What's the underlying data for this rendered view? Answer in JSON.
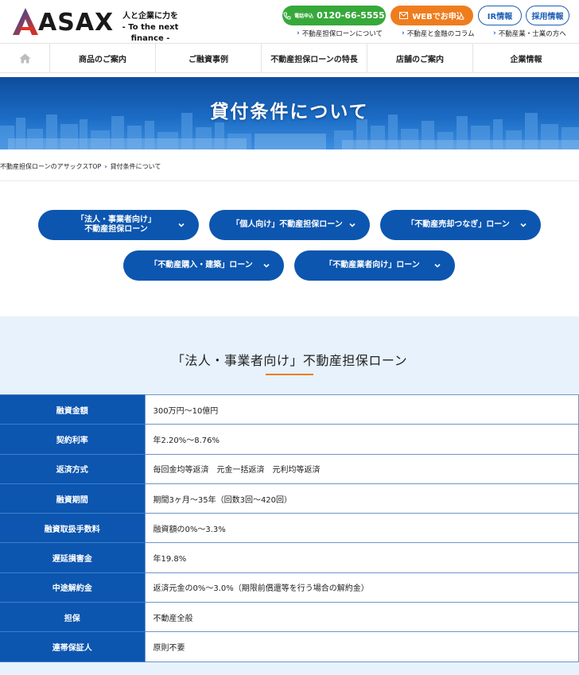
{
  "header": {
    "logo_text": "ASAX",
    "tagline_jp": "人と企業に力を",
    "tagline_en": "- To the next finance -",
    "tel_prefix": "電話申込",
    "tel_number": "0120-66-5555",
    "web_apply": "WEBでお申込",
    "ir": "IR情報",
    "recruit": "採用情報",
    "sublinks": [
      "不動産担保ローンについて",
      "不動産と金融のコラム",
      "不動産業・士業の方へ"
    ]
  },
  "nav": {
    "home_icon": "home-icon",
    "items": [
      "商品のご案内",
      "ご融資事例",
      "不動産担保ローンの特長",
      "店舗のご案内",
      "企業情報"
    ]
  },
  "hero": {
    "title": "貸付条件について"
  },
  "breadcrumb": {
    "home": "不動産担保ローンのアサックスTOP",
    "current": "貸付条件について"
  },
  "loan_buttons": [
    "「法人・事業者向け」\n不動産担保ローン",
    "「個人向け」不動産担保ローン",
    "「不動産売却つなぎ」ローン",
    "「不動産購入・建築」ローン",
    "「不動産業者向け」ローン"
  ],
  "section": {
    "title": "「法人・事業者向け」不動産担保ローン",
    "rows": [
      {
        "label": "融資金額",
        "value": "300万円〜10億円"
      },
      {
        "label": "契約利率",
        "value": "年2.20%〜8.76%"
      },
      {
        "label": "返済方式",
        "value": "毎回金均等返済　元金一括返済　元利均等返済"
      },
      {
        "label": "融資期間",
        "value": "期間3ヶ月〜35年（回数3回〜420回）"
      },
      {
        "label": "融資取扱手数料",
        "value": "融資額の0%〜3.3%"
      },
      {
        "label": "遅延損害金",
        "value": "年19.8%"
      },
      {
        "label": "中途解約金",
        "value": "返済元金の0%〜3.0%（期限前償還等を行う場合の解約金）"
      },
      {
        "label": "担保",
        "value": "不動産全般"
      },
      {
        "label": "連帯保証人",
        "value": "原則不要"
      }
    ]
  },
  "colors": {
    "primary_blue": "#0c56b0",
    "tel_green": "#37a93a",
    "web_orange": "#ef7d1e",
    "section_bg": "#e7f2fc"
  }
}
